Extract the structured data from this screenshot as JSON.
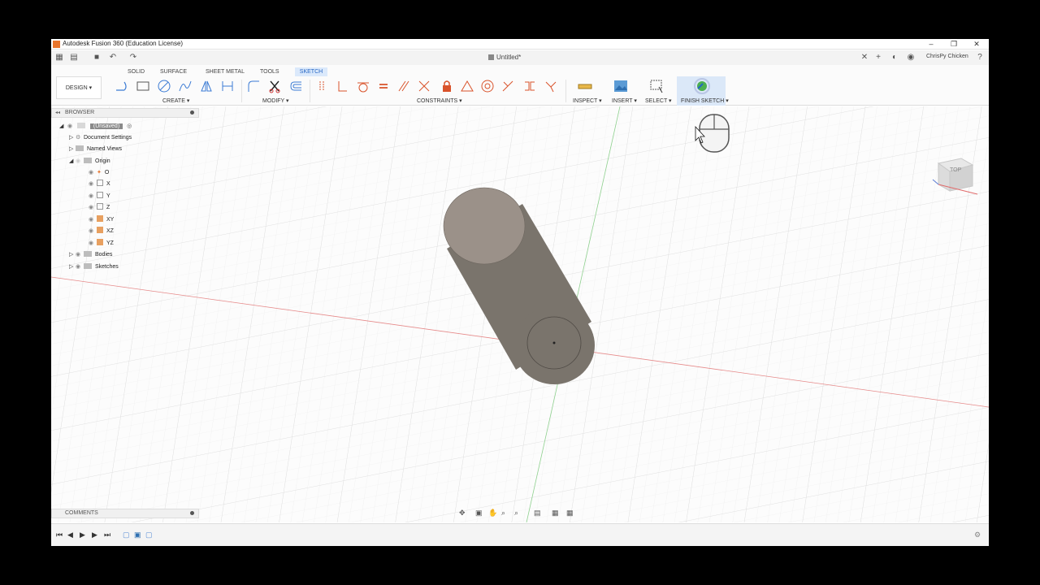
{
  "window": {
    "title": "Autodesk Fusion 360 (Education License)",
    "document_title": "Untitled*",
    "user": "ChrisPy Chicken"
  },
  "tabs": [
    {
      "label": "SOLID",
      "active": false
    },
    {
      "label": "SURFACE",
      "active": false
    },
    {
      "label": "SHEET METAL",
      "active": false
    },
    {
      "label": "TOOLS",
      "active": false
    },
    {
      "label": "SKETCH",
      "active": true
    }
  ],
  "workspace": {
    "label": "DESIGN ▾"
  },
  "groups": {
    "create": "CREATE ▾",
    "modify": "MODIFY ▾",
    "constraints": "CONSTRAINTS ▾",
    "inspect": "INSPECT ▾",
    "insert": "INSERT ▾",
    "select": "SELECT ▾",
    "finish": "FINISH SKETCH ▾"
  },
  "browser": {
    "title": "BROWSER",
    "root": "(Unsaved)",
    "items": [
      {
        "label": "Document Settings"
      },
      {
        "label": "Named Views"
      },
      {
        "label": "Origin"
      },
      {
        "label": "O"
      },
      {
        "label": "X"
      },
      {
        "label": "Y"
      },
      {
        "label": "Z"
      },
      {
        "label": "XY"
      },
      {
        "label": "XZ"
      },
      {
        "label": "YZ"
      },
      {
        "label": "Bodies"
      },
      {
        "label": "Sketches"
      }
    ]
  },
  "comments": {
    "label": "COMMENTS"
  },
  "viewcube": {
    "label": "TOP"
  },
  "colors": {
    "accent": "#2666c4",
    "body": "#7a746c",
    "cap": "#9b9189"
  }
}
